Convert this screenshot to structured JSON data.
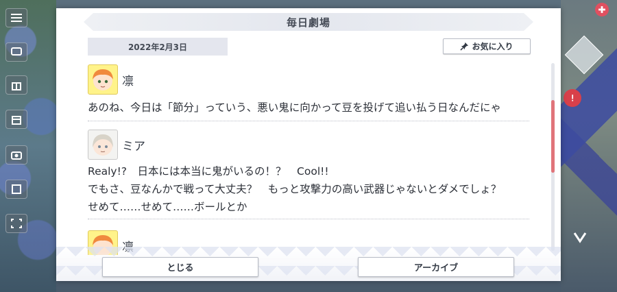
{
  "modal": {
    "title": "毎日劇場",
    "date": "2022年2月3日",
    "favorite_label": "お気に入り",
    "close_label": "とじる",
    "archive_label": "アーカイブ"
  },
  "entries": [
    {
      "speaker": "凛",
      "avatar": "rin-avatar",
      "lines": [
        "あのね、今日は「節分」っていう、悪い鬼に向かって豆を投げて追い払う日なんだにゃ"
      ]
    },
    {
      "speaker": "ミア",
      "avatar": "mia-avatar",
      "lines": [
        "Realy!?　日本には本当に鬼がいるの！？　Cool!!",
        "でもさ、豆なんかで戦って大丈夫？　もっと攻撃力の高い武器じゃないとダメでしょ？",
        "せめて……せめて……ボールとか"
      ]
    },
    {
      "speaker": "凛",
      "avatar": "rin-avatar",
      "lines": []
    }
  ],
  "icons": {
    "menu": "hamburger-menu-icon",
    "pin": "pin-icon"
  },
  "colors": {
    "scroll_thumb": "#e0747a",
    "title_bar": "#e4e7ee",
    "date_box": "#e4e6ee",
    "rin_avatar_bg": "#fff38a"
  }
}
